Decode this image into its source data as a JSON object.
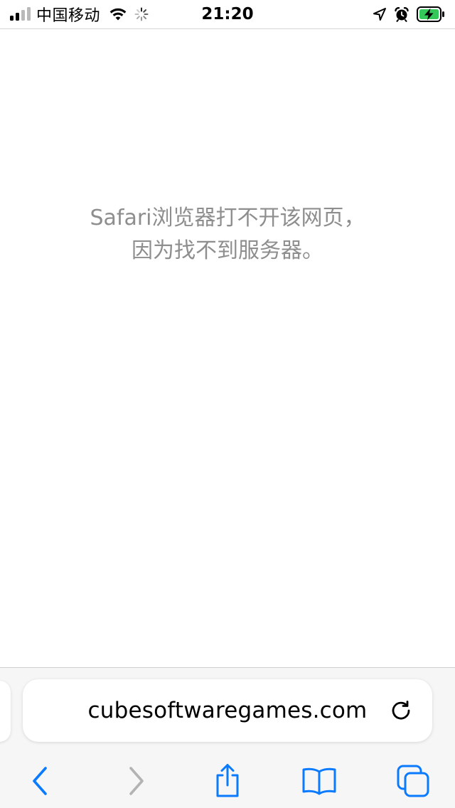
{
  "status_bar": {
    "carrier": "中国移动",
    "time": "21:20",
    "signal_bars_filled": 2,
    "signal_bars_total": 4,
    "icons": [
      "signal-icon",
      "wifi-icon",
      "activity-spinner-icon",
      "location-arrow-icon",
      "alarm-icon",
      "battery-charging-icon"
    ]
  },
  "error": {
    "line1": "Safari浏览器打不开该网页，",
    "line2": "因为找不到服务器。"
  },
  "address_bar": {
    "url": "cubesoftwaregames.com",
    "reload_icon": "reload-icon"
  },
  "toolbar": {
    "items": [
      {
        "name": "back",
        "icon": "chevron-left-icon",
        "enabled": true
      },
      {
        "name": "forward",
        "icon": "chevron-right-icon",
        "enabled": false
      },
      {
        "name": "share",
        "icon": "share-icon",
        "enabled": true
      },
      {
        "name": "bookmarks",
        "icon": "book-icon",
        "enabled": true
      },
      {
        "name": "tabs",
        "icon": "tabs-icon",
        "enabled": true
      }
    ]
  },
  "colors": {
    "accent": "#0a7aff",
    "disabled": "#b3b3b3",
    "message_text": "#8e8e8e",
    "battery_charging": "#34c759",
    "bar_background": "#f6f6f6"
  }
}
